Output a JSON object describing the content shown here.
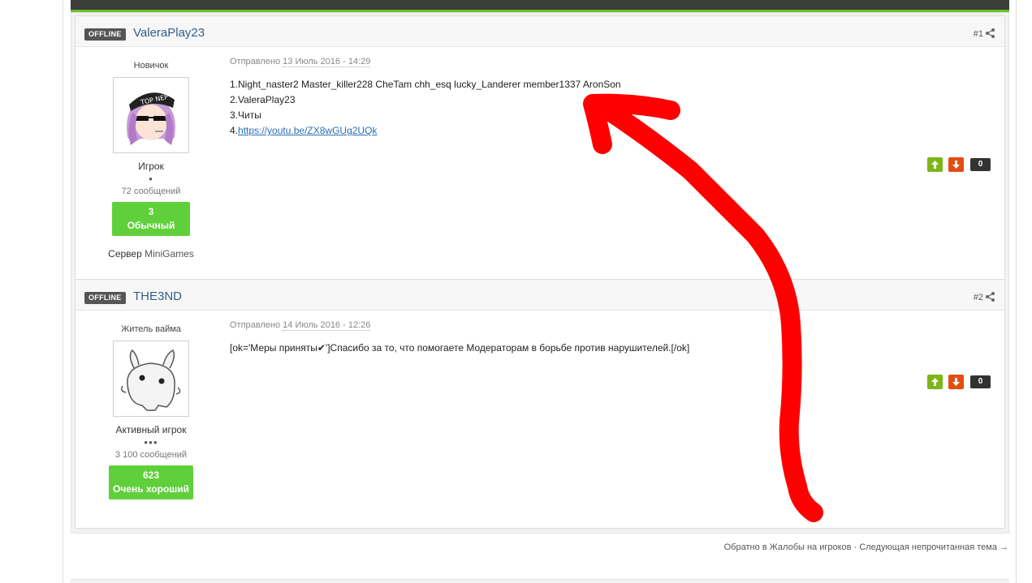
{
  "posts": [
    {
      "status": "OFFLINE",
      "author": "ValeraPlay23",
      "number": "#1",
      "rank_title": "Новичок",
      "avatar_icon": "anime-avatar-top-nep",
      "group": "Игрок",
      "pips": "●",
      "post_count": "72 сообщений",
      "rep_value": "3",
      "rep_label": "Обычный",
      "server_label": "Сервер",
      "server_name": "MiniGames",
      "posted_label": "Отправлено",
      "posted_date": "13 Июль 2016 - 14:29",
      "lines": [
        "1.Night_naster2 Master_killer228 CheTam chh_esq lucky_Landerer member1337 AronSon",
        "2.ValeraPlay23",
        "3.Читы"
      ],
      "link_prefix": "4.",
      "link_text": "https://youtu.be/ZX8wGUg2UQk",
      "vote_count": "0"
    },
    {
      "status": "OFFLINE",
      "author": "THE3ND",
      "number": "#2",
      "rank_title": "Житель вайма",
      "avatar_icon": "white-creature-avatar",
      "group": "Активный игрок",
      "pips": "●●●",
      "post_count": "3 100 сообщений",
      "rep_value": "623",
      "rep_label": "Очень хороший",
      "posted_label": "Отправлено",
      "posted_date": "14 Июль 2016 - 12:26",
      "content": "[ok='Меры приняты✔']Спасибо за то, что помогаете Модераторам в борьбе против нарушителей.[/ok]",
      "vote_count": "0"
    }
  ],
  "footer": {
    "back_link": "Обратно в Жалобы на игроков",
    "separator": "·",
    "next_link": "Следующая непрочитанная тема →"
  },
  "colors": {
    "rep_green": "#5fd03a",
    "vote_up": "#7cb518",
    "vote_down": "#e44d12",
    "author_blue": "#2f5f8a",
    "annotation_red": "#ff0000"
  }
}
